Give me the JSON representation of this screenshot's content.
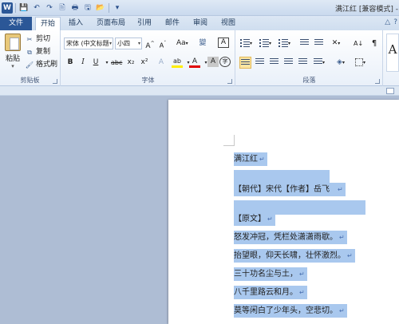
{
  "window": {
    "title": "满江红 [兼容模式] - M"
  },
  "qat": [
    "W",
    "💾",
    "↶",
    "↷",
    "🖹",
    "🖶",
    "🖫",
    "📂"
  ],
  "tabs": [
    {
      "label": "文件"
    },
    {
      "label": "开始"
    },
    {
      "label": "插入"
    },
    {
      "label": "页面布局"
    },
    {
      "label": "引用"
    },
    {
      "label": "邮件"
    },
    {
      "label": "审阅"
    },
    {
      "label": "视图"
    }
  ],
  "ribbon": {
    "clipboard": {
      "paste_label": "粘贴",
      "cut_label": "剪切",
      "copy_label": "复制",
      "format_painter_label": "格式刷",
      "group_label": "剪贴板"
    },
    "font": {
      "font_name": "宋体 (中文标题",
      "font_size": "小四",
      "grow_label": "A",
      "shrink_label": "A",
      "case_label": "Aa",
      "phonetic_label": "變",
      "border_char_label": "A",
      "bold": "B",
      "italic": "I",
      "underline": "U",
      "strike": "abc",
      "subscript": "x₂",
      "superscript": "x²",
      "effects": "A",
      "highlight": "ab",
      "color": "A",
      "shade": "A",
      "enclose": "字",
      "group_label": "字体"
    },
    "paragraph": {
      "group_label": "段落",
      "sort_label": "A↓",
      "show_marks": "¶"
    },
    "styles": {
      "sample": "A"
    }
  },
  "document": {
    "lines": [
      "满江红",
      "【朝代】宋代【作者】岳飞",
      "【原文】",
      "怒发冲冠，凭栏处潇潇雨歇。",
      "抬望眼，仰天长啸，壮怀激烈。",
      "三十功名尘与土，",
      "八千里路云和月。",
      "莫等闲白了少年头，空悲切。"
    ],
    "paragraph_mark": "↵",
    "highlight_color": "#a9c8ee"
  }
}
